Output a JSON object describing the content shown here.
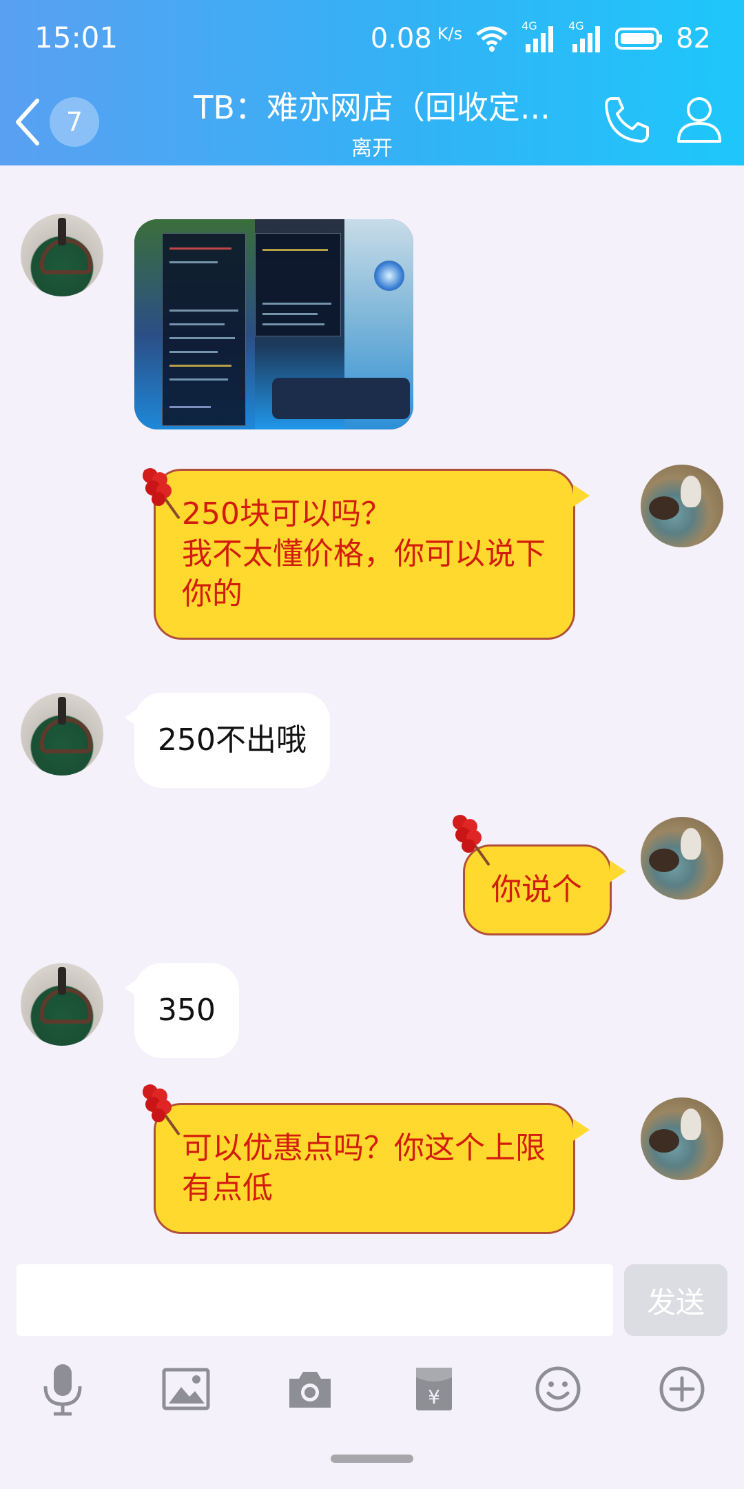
{
  "status_bar": {
    "time": "15:01",
    "net_speed": "0.08",
    "net_unit": "K/s",
    "signal_1": "4G",
    "signal_2": "4G",
    "battery": "82"
  },
  "header": {
    "unread_count": "7",
    "title": "TB：难亦网店（回收定...",
    "subtitle": "离开"
  },
  "messages": [
    {
      "side": "peer",
      "type": "image"
    },
    {
      "side": "me",
      "type": "text",
      "text": "250块可以吗？\n我不太懂价格，你可以说下\n你的"
    },
    {
      "side": "peer",
      "type": "text",
      "text": "250不出哦"
    },
    {
      "side": "me",
      "type": "text",
      "text": "你说个"
    },
    {
      "side": "peer",
      "type": "text",
      "text": "350"
    },
    {
      "side": "me",
      "type": "text",
      "text": "可以优惠点吗？你这个上限\n有点低"
    }
  ],
  "input": {
    "value": "",
    "send_label": "发送"
  },
  "toolbar": {
    "icons": [
      "microphone-icon",
      "image-icon",
      "camera-icon",
      "red-packet-icon",
      "emoji-icon",
      "plus-icon"
    ]
  },
  "colors": {
    "header_start": "#5aa0f2",
    "header_end": "#1ec7fb",
    "my_bubble": "#ffd92e",
    "my_text": "#d21c0c",
    "peer_bubble": "#ffffff",
    "background": "#f4f1fa"
  }
}
